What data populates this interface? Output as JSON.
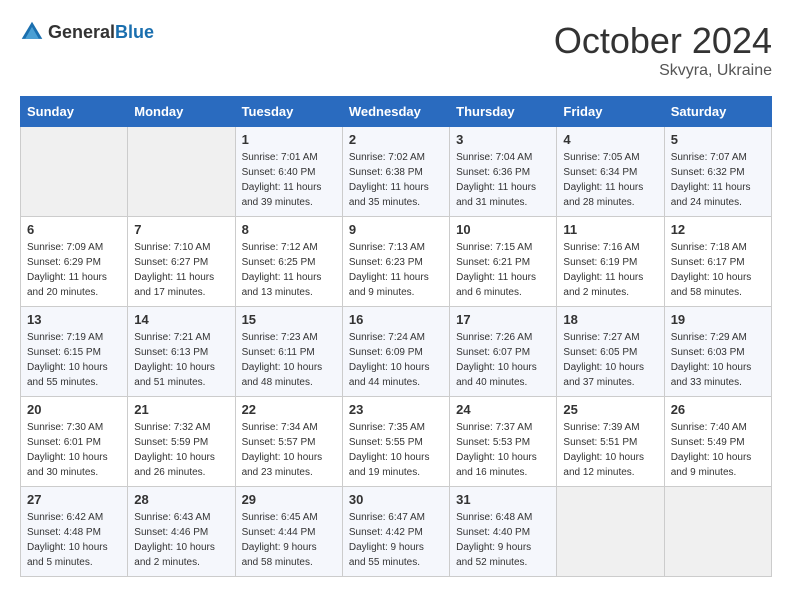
{
  "header": {
    "logo_general": "General",
    "logo_blue": "Blue",
    "month": "October 2024",
    "location": "Skvyra, Ukraine"
  },
  "weekdays": [
    "Sunday",
    "Monday",
    "Tuesday",
    "Wednesday",
    "Thursday",
    "Friday",
    "Saturday"
  ],
  "weeks": [
    [
      {
        "day": "",
        "info": ""
      },
      {
        "day": "",
        "info": ""
      },
      {
        "day": "1",
        "info": "Sunrise: 7:01 AM\nSunset: 6:40 PM\nDaylight: 11 hours\nand 39 minutes."
      },
      {
        "day": "2",
        "info": "Sunrise: 7:02 AM\nSunset: 6:38 PM\nDaylight: 11 hours\nand 35 minutes."
      },
      {
        "day": "3",
        "info": "Sunrise: 7:04 AM\nSunset: 6:36 PM\nDaylight: 11 hours\nand 31 minutes."
      },
      {
        "day": "4",
        "info": "Sunrise: 7:05 AM\nSunset: 6:34 PM\nDaylight: 11 hours\nand 28 minutes."
      },
      {
        "day": "5",
        "info": "Sunrise: 7:07 AM\nSunset: 6:32 PM\nDaylight: 11 hours\nand 24 minutes."
      }
    ],
    [
      {
        "day": "6",
        "info": "Sunrise: 7:09 AM\nSunset: 6:29 PM\nDaylight: 11 hours\nand 20 minutes."
      },
      {
        "day": "7",
        "info": "Sunrise: 7:10 AM\nSunset: 6:27 PM\nDaylight: 11 hours\nand 17 minutes."
      },
      {
        "day": "8",
        "info": "Sunrise: 7:12 AM\nSunset: 6:25 PM\nDaylight: 11 hours\nand 13 minutes."
      },
      {
        "day": "9",
        "info": "Sunrise: 7:13 AM\nSunset: 6:23 PM\nDaylight: 11 hours\nand 9 minutes."
      },
      {
        "day": "10",
        "info": "Sunrise: 7:15 AM\nSunset: 6:21 PM\nDaylight: 11 hours\nand 6 minutes."
      },
      {
        "day": "11",
        "info": "Sunrise: 7:16 AM\nSunset: 6:19 PM\nDaylight: 11 hours\nand 2 minutes."
      },
      {
        "day": "12",
        "info": "Sunrise: 7:18 AM\nSunset: 6:17 PM\nDaylight: 10 hours\nand 58 minutes."
      }
    ],
    [
      {
        "day": "13",
        "info": "Sunrise: 7:19 AM\nSunset: 6:15 PM\nDaylight: 10 hours\nand 55 minutes."
      },
      {
        "day": "14",
        "info": "Sunrise: 7:21 AM\nSunset: 6:13 PM\nDaylight: 10 hours\nand 51 minutes."
      },
      {
        "day": "15",
        "info": "Sunrise: 7:23 AM\nSunset: 6:11 PM\nDaylight: 10 hours\nand 48 minutes."
      },
      {
        "day": "16",
        "info": "Sunrise: 7:24 AM\nSunset: 6:09 PM\nDaylight: 10 hours\nand 44 minutes."
      },
      {
        "day": "17",
        "info": "Sunrise: 7:26 AM\nSunset: 6:07 PM\nDaylight: 10 hours\nand 40 minutes."
      },
      {
        "day": "18",
        "info": "Sunrise: 7:27 AM\nSunset: 6:05 PM\nDaylight: 10 hours\nand 37 minutes."
      },
      {
        "day": "19",
        "info": "Sunrise: 7:29 AM\nSunset: 6:03 PM\nDaylight: 10 hours\nand 33 minutes."
      }
    ],
    [
      {
        "day": "20",
        "info": "Sunrise: 7:30 AM\nSunset: 6:01 PM\nDaylight: 10 hours\nand 30 minutes."
      },
      {
        "day": "21",
        "info": "Sunrise: 7:32 AM\nSunset: 5:59 PM\nDaylight: 10 hours\nand 26 minutes."
      },
      {
        "day": "22",
        "info": "Sunrise: 7:34 AM\nSunset: 5:57 PM\nDaylight: 10 hours\nand 23 minutes."
      },
      {
        "day": "23",
        "info": "Sunrise: 7:35 AM\nSunset: 5:55 PM\nDaylight: 10 hours\nand 19 minutes."
      },
      {
        "day": "24",
        "info": "Sunrise: 7:37 AM\nSunset: 5:53 PM\nDaylight: 10 hours\nand 16 minutes."
      },
      {
        "day": "25",
        "info": "Sunrise: 7:39 AM\nSunset: 5:51 PM\nDaylight: 10 hours\nand 12 minutes."
      },
      {
        "day": "26",
        "info": "Sunrise: 7:40 AM\nSunset: 5:49 PM\nDaylight: 10 hours\nand 9 minutes."
      }
    ],
    [
      {
        "day": "27",
        "info": "Sunrise: 6:42 AM\nSunset: 4:48 PM\nDaylight: 10 hours\nand 5 minutes."
      },
      {
        "day": "28",
        "info": "Sunrise: 6:43 AM\nSunset: 4:46 PM\nDaylight: 10 hours\nand 2 minutes."
      },
      {
        "day": "29",
        "info": "Sunrise: 6:45 AM\nSunset: 4:44 PM\nDaylight: 9 hours\nand 58 minutes."
      },
      {
        "day": "30",
        "info": "Sunrise: 6:47 AM\nSunset: 4:42 PM\nDaylight: 9 hours\nand 55 minutes."
      },
      {
        "day": "31",
        "info": "Sunrise: 6:48 AM\nSunset: 4:40 PM\nDaylight: 9 hours\nand 52 minutes."
      },
      {
        "day": "",
        "info": ""
      },
      {
        "day": "",
        "info": ""
      }
    ]
  ]
}
